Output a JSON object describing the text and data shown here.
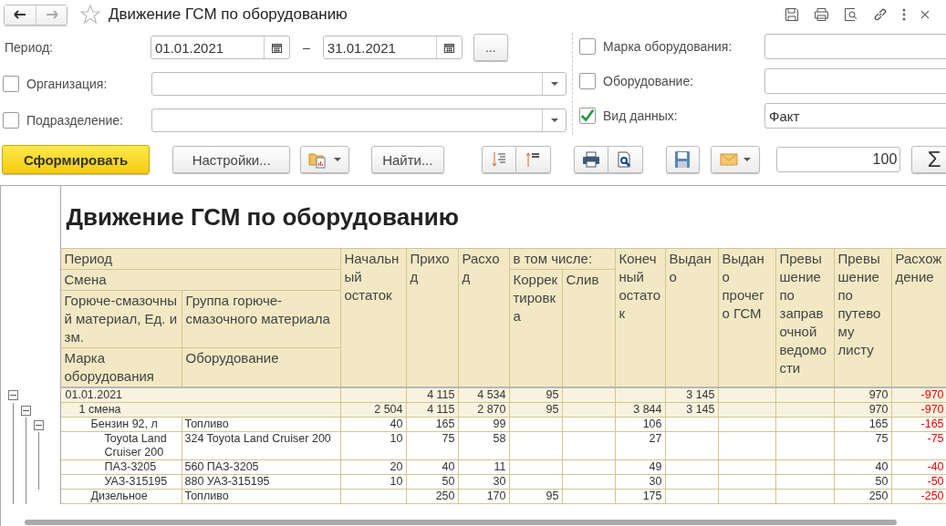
{
  "window": {
    "title": "Движение ГСМ по оборудованию"
  },
  "filters_left": [
    {
      "kind": "period",
      "label": "Период:",
      "from": "01.01.2021",
      "separator": "–",
      "to": "31.01.2021",
      "more": "..."
    },
    {
      "kind": "select",
      "label": "Организация:",
      "checked": false
    },
    {
      "kind": "select",
      "label": "Подразделение:",
      "checked": false
    }
  ],
  "filters_right": [
    {
      "label": "Марка оборудования:",
      "checked": false
    },
    {
      "label": "Оборудование:",
      "checked": false
    },
    {
      "label": "Вид данных:",
      "checked": true,
      "value": "Факт"
    }
  ],
  "toolbar": {
    "generate": "Сформировать",
    "settings": "Настройки...",
    "find": "Найти...",
    "scale": "100",
    "sum": "Σ"
  },
  "report": {
    "title": "Движение ГСМ по оборудованию",
    "header": {
      "period": "Период",
      "shift": "Смена",
      "material": "Горюче-смазочный материал, Ед. изм.",
      "group": "Группа горюче-смазочного материала",
      "brand": "Марка оборудования",
      "equipment": "Оборудование",
      "including": "в том числе:",
      "opening": "Начальный остаток",
      "income": "Приход",
      "expense": "Расход",
      "correction": "Корректировка",
      "drain": "Слив",
      "closing": "Конечный остаток",
      "issued": "Выдано",
      "issued_other": "Выдано прочего ГСМ",
      "excess_fueling": "Превышение по заправочной ведомости",
      "excess_waybill": "Превышение по путевому листу",
      "difference": "Расхождение"
    },
    "rows": [
      {
        "kind": "period",
        "label": "01.01.2021",
        "expanded": true,
        "income": "4 115",
        "expense": "4 534",
        "correction": "95",
        "issued": "3 145",
        "excess_waybill": "970",
        "difference": "-970",
        "children": [
          {
            "kind": "shift",
            "label": "1 смена",
            "expanded": true,
            "opening": "2 504",
            "income": "4 115",
            "expense": "2 870",
            "correction": "95",
            "closing": "3 844",
            "issued": "3 145",
            "excess_waybill": "970",
            "difference": "-970",
            "children": [
              {
                "kind": "material",
                "label": "Бензин 92, л",
                "group": "Топливо",
                "expanded": true,
                "opening": "40",
                "income": "165",
                "expense": "99",
                "closing": "106",
                "excess_waybill": "165",
                "difference": "-165",
                "children": [
                  {
                    "kind": "equipment",
                    "label": "Toyota Land Cruiser 200",
                    "group": "324 Toyota Land Cruiser 200",
                    "opening": "10",
                    "income": "75",
                    "expense": "58",
                    "closing": "27",
                    "excess_waybill": "75",
                    "difference": "-75"
                  },
                  {
                    "kind": "equipment",
                    "label": "ПАЗ-3205",
                    "group": "560 ПАЗ-3205",
                    "opening": "20",
                    "income": "40",
                    "expense": "11",
                    "closing": "49",
                    "excess_waybill": "40",
                    "difference": "-40"
                  },
                  {
                    "kind": "equipment",
                    "label": "УАЗ-315195",
                    "group": "880 УАЗ-315195",
                    "opening": "10",
                    "income": "50",
                    "expense": "30",
                    "closing": "30",
                    "excess_waybill": "50",
                    "difference": "-50"
                  }
                ]
              },
              {
                "kind": "material",
                "label": "Дизельное",
                "group": "Топливо",
                "income": "250",
                "expense": "170",
                "correction": "95",
                "closing": "175",
                "excess_waybill": "250",
                "difference": "-250"
              }
            ]
          }
        ]
      }
    ]
  }
}
